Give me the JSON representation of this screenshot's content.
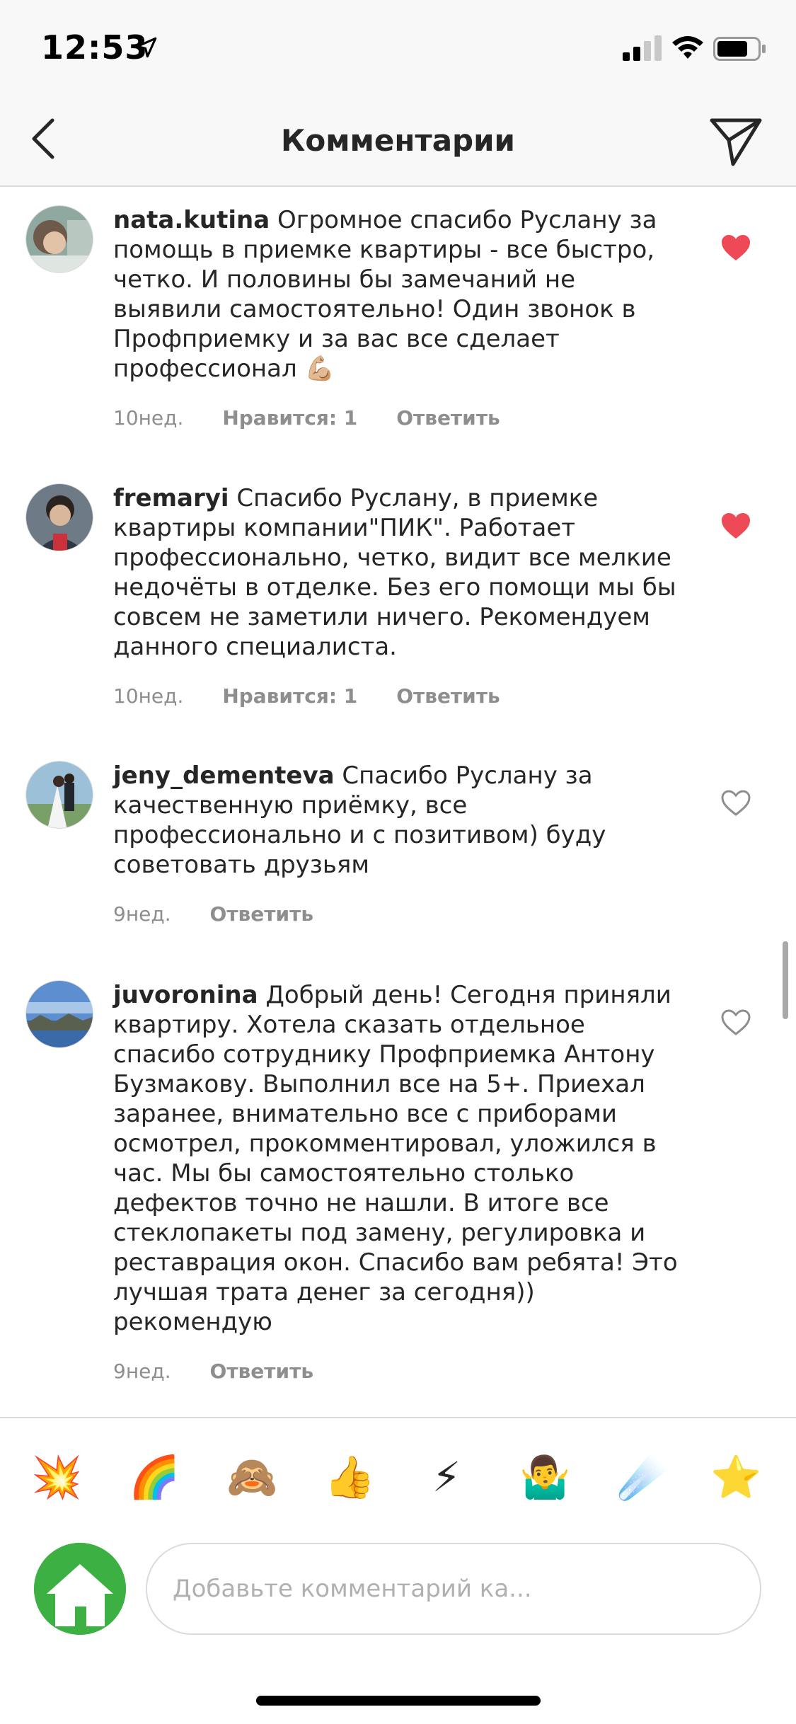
{
  "status_bar": {
    "time": "12:53"
  },
  "header": {
    "title": "Комментарии"
  },
  "comments": [
    {
      "username": "nata.kutina",
      "text": "Огромное спасибо Руслану за помощь в приемке квартиры - все быстро, четко. И половины бы замечаний не выявили самостоятельно! Один звонок в Профприемку и за вас все сделает профессионал 💪🏼",
      "time": "10нед.",
      "likes": "Нравится: 1",
      "reply": "Ответить",
      "liked": true
    },
    {
      "username": "fremaryi",
      "text": "Спасибо Руслану, в приемке квартиры компании\"ПИК\". Работает профессионально, четко, видит все мелкие недочёты в отделке. Без его помощи мы бы совсем не заметили ничего. Рекомендуем данного специалиста.",
      "time": "10нед.",
      "likes": "Нравится: 1",
      "reply": "Ответить",
      "liked": true
    },
    {
      "username": "jeny_dementeva",
      "text": "Спасибо Руслану за качественную приёмку, все профессионально и с позитивом) буду советовать друзьям",
      "time": "9нед.",
      "reply": "Ответить",
      "liked": false
    },
    {
      "username": "juvoronina",
      "text": "Добрый день! Сегодня приняли квартиру. Хотела сказать отдельное спасибо сотруднику Профприемка Антону Бузмакову. Выполнил все на 5+. Приехал заранее, внимательно все с приборами осмотрел, прокомментировал, уложился в час. Мы бы самостоятельно столько дефектов точно не нашли. В итоге все стеклопакеты под замену, регулировка и реставрация окон. Спасибо вам ребята! Это лучшая трата денег за сегодня)) рекомендую",
      "time": "9нед.",
      "reply": "Ответить",
      "liked": false
    }
  ],
  "emoji_bar": [
    "💥",
    "🌈",
    "🙈",
    "👍",
    "⚡",
    "🤷‍♂️",
    "☄️",
    "⭐"
  ],
  "input": {
    "placeholder": "Добавьте комментарий ка..."
  },
  "colors": {
    "heart_liked": "#ed4956",
    "meta_text": "#8e8e8e",
    "self_avatar": "#3cb043"
  }
}
